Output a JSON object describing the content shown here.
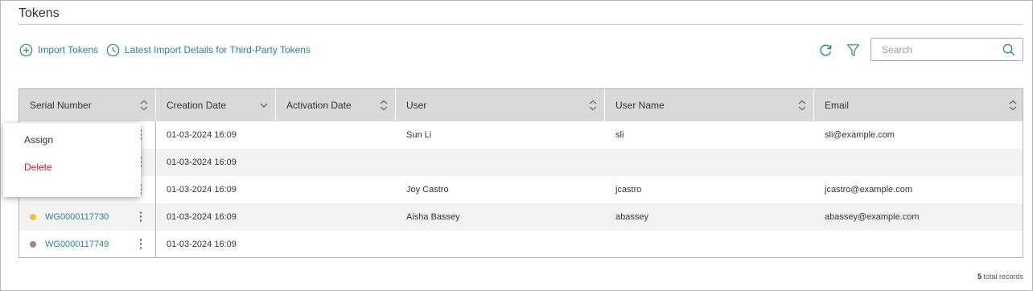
{
  "page": {
    "title": "Tokens"
  },
  "toolbar": {
    "import_label": "Import Tokens",
    "latest_import_label": "Latest Import Details for Third-Party Tokens",
    "search_placeholder": "Search",
    "search_value": ""
  },
  "table": {
    "columns": [
      {
        "label": "Serial Number",
        "sort": "unsorted"
      },
      {
        "label": "Creation Date",
        "sort": "descending"
      },
      {
        "label": "Activation Date",
        "sort": "unsorted"
      },
      {
        "label": "User",
        "sort": "unsorted"
      },
      {
        "label": "User Name",
        "sort": "unsorted"
      },
      {
        "label": "Email",
        "sort": "unsorted"
      }
    ],
    "rows": [
      {
        "status_color": "",
        "serial": "",
        "creation_date": "01-03-2024 16:09",
        "activation_date": "",
        "user": "Sun Li",
        "user_name": "sli",
        "email": "sli@example.com"
      },
      {
        "status_color": "",
        "serial": "",
        "creation_date": "01-03-2024 16:09",
        "activation_date": "",
        "user": "",
        "user_name": "",
        "email": ""
      },
      {
        "status_color": "",
        "serial": "",
        "creation_date": "01-03-2024 16:09",
        "activation_date": "",
        "user": "Joy Castro",
        "user_name": "jcastro",
        "email": "jcastro@example.com"
      },
      {
        "status_color": "#f0c23b",
        "serial": "WG0000117730",
        "creation_date": "01-03-2024 16:09",
        "activation_date": "",
        "user": "Aisha Bassey",
        "user_name": "abassey",
        "email": "abassey@example.com"
      },
      {
        "status_color": "#8c8c8c",
        "serial": "WG0000117749",
        "creation_date": "01-03-2024 16:09",
        "activation_date": "",
        "user": "",
        "user_name": "",
        "email": ""
      }
    ]
  },
  "context_menu": {
    "assign_label": "Assign",
    "delete_label": "Delete"
  },
  "footer": {
    "count": "5",
    "count_suffix": " total records"
  },
  "icons": {
    "import": "plus-circle-icon",
    "latest_import": "clock-icon",
    "refresh": "refresh-icon",
    "filter": "filter-icon",
    "search": "search-icon",
    "row_actions": "kebab-icon"
  },
  "colors": {
    "accent": "#2f7f9a",
    "danger": "#d02020",
    "header_bg": "#d9d9d9",
    "alt_row_bg": "#f2f2f2"
  }
}
